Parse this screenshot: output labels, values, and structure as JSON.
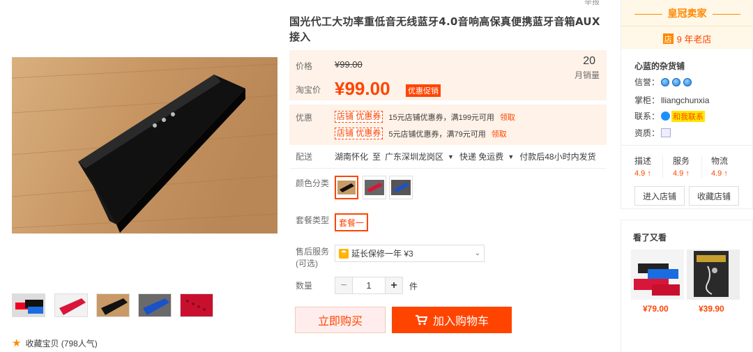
{
  "product": {
    "title": "国光代工大功率重低音无线蓝牙4.0音响高保真便携蓝牙音箱AUX接入",
    "top_cutoff": "举报"
  },
  "gallery": {
    "favorite_label": "收藏宝贝 (798人气)"
  },
  "price": {
    "price_label": "价格",
    "original": "¥99.00",
    "taobao_label": "淘宝价",
    "current": "¥99.00",
    "promo_tag": "优惠促销",
    "sales_count": "20",
    "sales_label": "月销量"
  },
  "coupons": {
    "label": "优惠",
    "items": [
      {
        "tag": "店铺 优惠券",
        "text": "15元店铺优惠券，满199元可用",
        "link": "领取"
      },
      {
        "tag": "店铺 优惠券",
        "text": "5元店铺优惠券，满79元可用",
        "link": "领取"
      }
    ]
  },
  "delivery": {
    "label": "配送",
    "from": "湖南怀化",
    "to_word": "至",
    "to": "广东深圳龙岗区",
    "express": "快递 免运费",
    "ship_time": "付款后48小时内发货"
  },
  "options": {
    "color_label": "颜色分类",
    "combo_label": "套餐类型",
    "combo_value": "套餐一",
    "service_label": "售后服务",
    "service_optional": "(可选)",
    "service_value": "延长保修一年 ¥3",
    "qty_label": "数量",
    "qty_value": "1",
    "qty_unit": "件"
  },
  "actions": {
    "buy_now": "立即购买",
    "add_cart": "加入购物车"
  },
  "shop": {
    "crown": "皇冠卖家",
    "years": "9 年老店",
    "shop_icon": "店",
    "name": "心蓝的杂货铺",
    "credit_label": "信誉：",
    "owner_label": "掌柜：",
    "owner": "lliangchunxia",
    "contact_label": "联系：",
    "contact_btn": "和我联系",
    "cert_label": "资质：",
    "scores": [
      {
        "label": "描述",
        "value": "4.9 ↑"
      },
      {
        "label": "服务",
        "value": "4.9 ↑"
      },
      {
        "label": "物流",
        "value": "4.9 ↑"
      }
    ],
    "enter_btn": "进入店铺",
    "collect_btn": "收藏店铺"
  },
  "seen": {
    "title": "看了又看",
    "items": [
      {
        "price": "¥79.00"
      },
      {
        "price": "¥39.90"
      }
    ]
  },
  "colors": {
    "accent": "#ff4400",
    "price_bg": "#fff2e8",
    "crown": "#ff8800"
  }
}
